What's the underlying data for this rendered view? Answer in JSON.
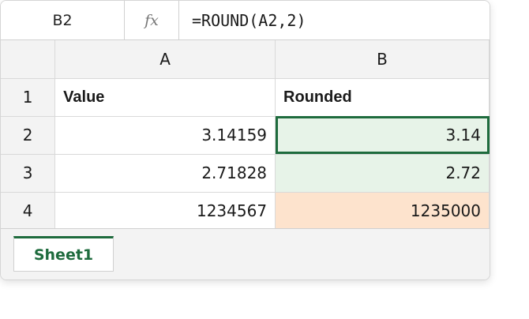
{
  "formula_bar": {
    "name_box": "B2",
    "fx_label": "fx",
    "formula": "=ROUND(A2,2)"
  },
  "grid": {
    "columns": [
      "A",
      "B"
    ],
    "rows": [
      {
        "row": "1",
        "a": "Value",
        "b": "Rounded"
      },
      {
        "row": "2",
        "a": "3.14159",
        "b": "3.14"
      },
      {
        "row": "3",
        "a": "2.71828",
        "b": "2.72"
      },
      {
        "row": "4",
        "a": "1234567",
        "b": "1235000"
      }
    ],
    "active_cell": "B2",
    "colors": {
      "active_border": "#1e6b3d",
      "green_fill": "#e7f3e8",
      "orange_fill": "#fde3cd"
    }
  },
  "sheets": {
    "tabs": [
      {
        "label": "Sheet1",
        "active": true
      }
    ]
  }
}
